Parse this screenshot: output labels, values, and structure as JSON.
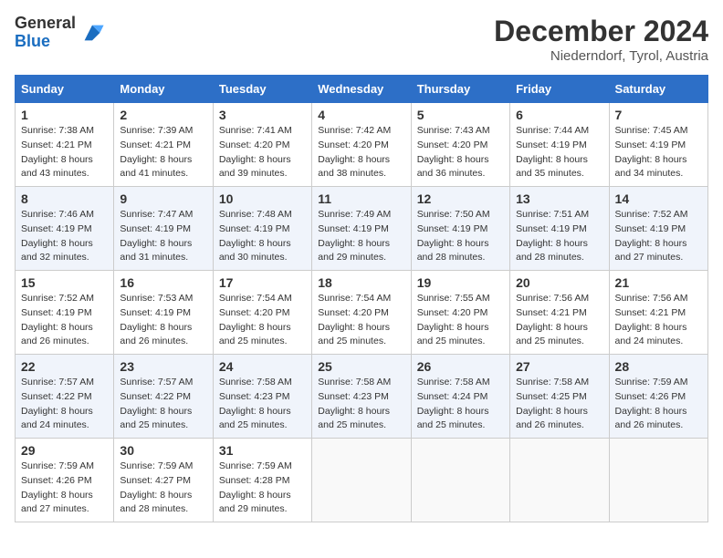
{
  "header": {
    "logo_general": "General",
    "logo_blue": "Blue",
    "month_title": "December 2024",
    "location": "Niederndorf, Tyrol, Austria"
  },
  "weekdays": [
    "Sunday",
    "Monday",
    "Tuesday",
    "Wednesday",
    "Thursday",
    "Friday",
    "Saturday"
  ],
  "weeks": [
    [
      {
        "day": "1",
        "sunrise": "7:38 AM",
        "sunset": "4:21 PM",
        "daylight": "8 hours and 43 minutes."
      },
      {
        "day": "2",
        "sunrise": "7:39 AM",
        "sunset": "4:21 PM",
        "daylight": "8 hours and 41 minutes."
      },
      {
        "day": "3",
        "sunrise": "7:41 AM",
        "sunset": "4:20 PM",
        "daylight": "8 hours and 39 minutes."
      },
      {
        "day": "4",
        "sunrise": "7:42 AM",
        "sunset": "4:20 PM",
        "daylight": "8 hours and 38 minutes."
      },
      {
        "day": "5",
        "sunrise": "7:43 AM",
        "sunset": "4:20 PM",
        "daylight": "8 hours and 36 minutes."
      },
      {
        "day": "6",
        "sunrise": "7:44 AM",
        "sunset": "4:19 PM",
        "daylight": "8 hours and 35 minutes."
      },
      {
        "day": "7",
        "sunrise": "7:45 AM",
        "sunset": "4:19 PM",
        "daylight": "8 hours and 34 minutes."
      }
    ],
    [
      {
        "day": "8",
        "sunrise": "7:46 AM",
        "sunset": "4:19 PM",
        "daylight": "8 hours and 32 minutes."
      },
      {
        "day": "9",
        "sunrise": "7:47 AM",
        "sunset": "4:19 PM",
        "daylight": "8 hours and 31 minutes."
      },
      {
        "day": "10",
        "sunrise": "7:48 AM",
        "sunset": "4:19 PM",
        "daylight": "8 hours and 30 minutes."
      },
      {
        "day": "11",
        "sunrise": "7:49 AM",
        "sunset": "4:19 PM",
        "daylight": "8 hours and 29 minutes."
      },
      {
        "day": "12",
        "sunrise": "7:50 AM",
        "sunset": "4:19 PM",
        "daylight": "8 hours and 28 minutes."
      },
      {
        "day": "13",
        "sunrise": "7:51 AM",
        "sunset": "4:19 PM",
        "daylight": "8 hours and 28 minutes."
      },
      {
        "day": "14",
        "sunrise": "7:52 AM",
        "sunset": "4:19 PM",
        "daylight": "8 hours and 27 minutes."
      }
    ],
    [
      {
        "day": "15",
        "sunrise": "7:52 AM",
        "sunset": "4:19 PM",
        "daylight": "8 hours and 26 minutes."
      },
      {
        "day": "16",
        "sunrise": "7:53 AM",
        "sunset": "4:19 PM",
        "daylight": "8 hours and 26 minutes."
      },
      {
        "day": "17",
        "sunrise": "7:54 AM",
        "sunset": "4:20 PM",
        "daylight": "8 hours and 25 minutes."
      },
      {
        "day": "18",
        "sunrise": "7:54 AM",
        "sunset": "4:20 PM",
        "daylight": "8 hours and 25 minutes."
      },
      {
        "day": "19",
        "sunrise": "7:55 AM",
        "sunset": "4:20 PM",
        "daylight": "8 hours and 25 minutes."
      },
      {
        "day": "20",
        "sunrise": "7:56 AM",
        "sunset": "4:21 PM",
        "daylight": "8 hours and 25 minutes."
      },
      {
        "day": "21",
        "sunrise": "7:56 AM",
        "sunset": "4:21 PM",
        "daylight": "8 hours and 24 minutes."
      }
    ],
    [
      {
        "day": "22",
        "sunrise": "7:57 AM",
        "sunset": "4:22 PM",
        "daylight": "8 hours and 24 minutes."
      },
      {
        "day": "23",
        "sunrise": "7:57 AM",
        "sunset": "4:22 PM",
        "daylight": "8 hours and 25 minutes."
      },
      {
        "day": "24",
        "sunrise": "7:58 AM",
        "sunset": "4:23 PM",
        "daylight": "8 hours and 25 minutes."
      },
      {
        "day": "25",
        "sunrise": "7:58 AM",
        "sunset": "4:23 PM",
        "daylight": "8 hours and 25 minutes."
      },
      {
        "day": "26",
        "sunrise": "7:58 AM",
        "sunset": "4:24 PM",
        "daylight": "8 hours and 25 minutes."
      },
      {
        "day": "27",
        "sunrise": "7:58 AM",
        "sunset": "4:25 PM",
        "daylight": "8 hours and 26 minutes."
      },
      {
        "day": "28",
        "sunrise": "7:59 AM",
        "sunset": "4:26 PM",
        "daylight": "8 hours and 26 minutes."
      }
    ],
    [
      {
        "day": "29",
        "sunrise": "7:59 AM",
        "sunset": "4:26 PM",
        "daylight": "8 hours and 27 minutes."
      },
      {
        "day": "30",
        "sunrise": "7:59 AM",
        "sunset": "4:27 PM",
        "daylight": "8 hours and 28 minutes."
      },
      {
        "day": "31",
        "sunrise": "7:59 AM",
        "sunset": "4:28 PM",
        "daylight": "8 hours and 29 minutes."
      },
      null,
      null,
      null,
      null
    ]
  ]
}
